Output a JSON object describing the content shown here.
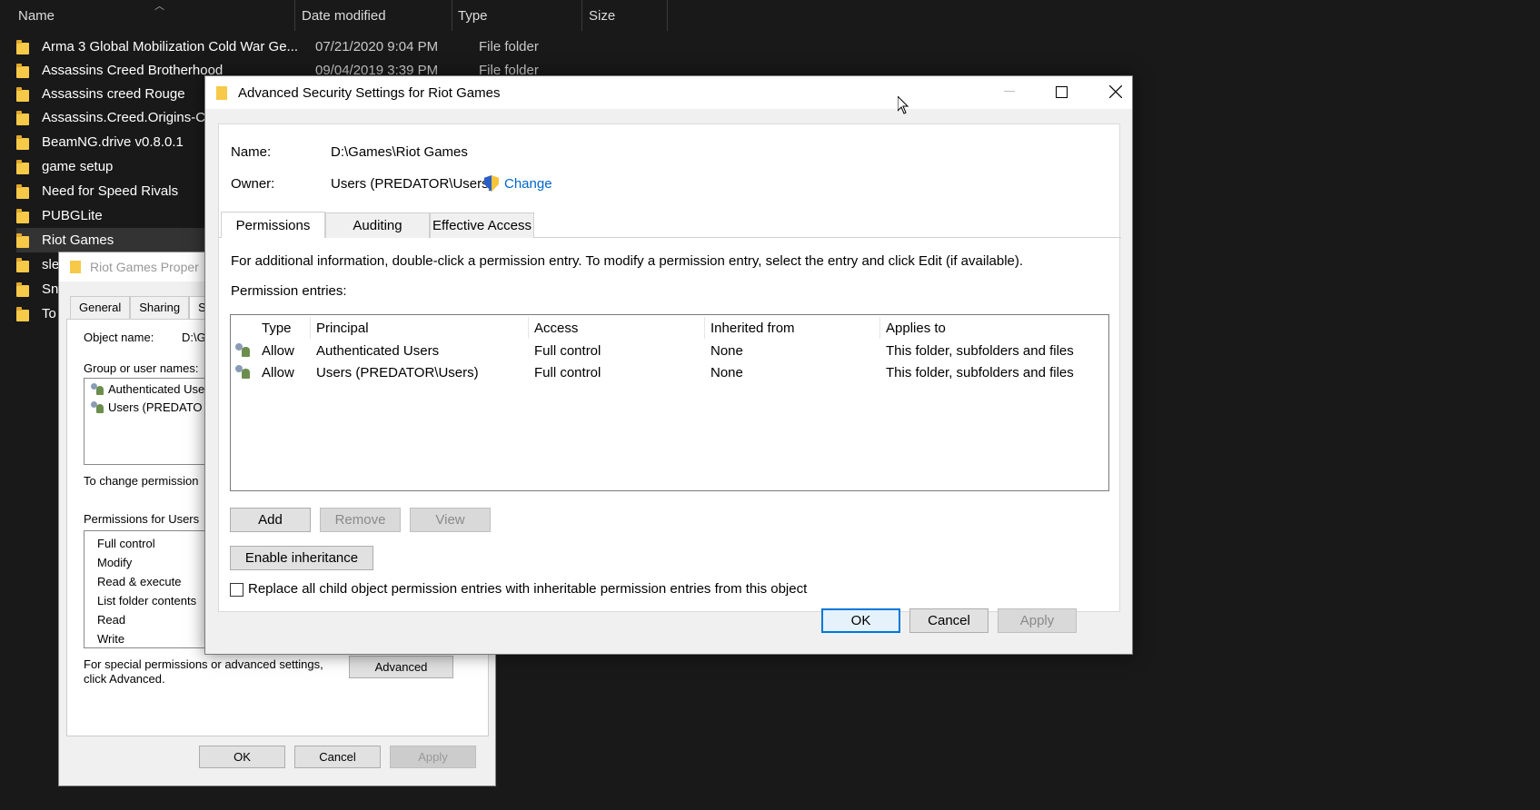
{
  "explorer": {
    "columns": {
      "name": "Name",
      "date": "Date modified",
      "type": "Type",
      "size": "Size"
    },
    "files": [
      {
        "name": "Arma 3 Global Mobilization Cold War Ge...",
        "date": "07/21/2020 9:04 PM",
        "type": "File folder"
      },
      {
        "name": "Assassins Creed Brotherhood",
        "date": "09/04/2019 3:39 PM",
        "type": "File folder"
      },
      {
        "name": "Assassins creed Rouge",
        "date": "",
        "type": ""
      },
      {
        "name": "Assassins.Creed.Origins-CPY",
        "date": "",
        "type": ""
      },
      {
        "name": "BeamNG.drive v0.8.0.1",
        "date": "",
        "type": ""
      },
      {
        "name": "game setup",
        "date": "",
        "type": ""
      },
      {
        "name": "Need for Speed Rivals",
        "date": "",
        "type": ""
      },
      {
        "name": "PUBGLite",
        "date": "",
        "type": ""
      },
      {
        "name": "Riot Games",
        "date": "",
        "type": ""
      },
      {
        "name": "sle",
        "date": "",
        "type": ""
      },
      {
        "name": "Sn",
        "date": "",
        "type": ""
      },
      {
        "name": "To",
        "date": "",
        "type": ""
      }
    ]
  },
  "properties": {
    "title": "Riot Games Proper",
    "tabs": [
      "General",
      "Sharing",
      "S"
    ],
    "object_name_label": "Object name:",
    "object_name_value": "D:\\G",
    "group_label": "Group or user names:",
    "users": [
      "Authenticated Use",
      "Users (PREDATO"
    ],
    "change_perm_text": "To change permission",
    "perm_for_label": "Permissions for Users",
    "permissions": [
      "Full control",
      "Modify",
      "Read & execute",
      "List folder contents",
      "Read",
      "Write"
    ],
    "special_text_1": "For special permissions or advanced settings,",
    "special_text_2": "click Advanced.",
    "advanced_btn": "Advanced",
    "ok": "OK",
    "cancel": "Cancel",
    "apply": "Apply"
  },
  "advanced": {
    "title": "Advanced Security Settings for Riot Games",
    "name_label": "Name:",
    "name_value": "D:\\Games\\Riot Games",
    "owner_label": "Owner:",
    "owner_value": "Users (PREDATOR\\Users)",
    "change_link": "Change",
    "tabs": [
      "Permissions",
      "Auditing",
      "Effective Access"
    ],
    "info_text": "For additional information, double-click a permission entry. To modify a permission entry, select the entry and click Edit (if available).",
    "entries_label": "Permission entries:",
    "table_headers": [
      "Type",
      "Principal",
      "Access",
      "Inherited from",
      "Applies to"
    ],
    "entries": [
      {
        "type": "Allow",
        "principal": "Authenticated Users",
        "access": "Full control",
        "inherited": "None",
        "applies": "This folder, subfolders and files"
      },
      {
        "type": "Allow",
        "principal": "Users (PREDATOR\\Users)",
        "access": "Full control",
        "inherited": "None",
        "applies": "This folder, subfolders and files"
      }
    ],
    "add_btn": "Add",
    "remove_btn": "Remove",
    "view_btn": "View",
    "enable_inheritance_btn": "Enable inheritance",
    "replace_checkbox_label": "Replace all child object permission entries with inheritable permission entries from this object",
    "ok": "OK",
    "cancel": "Cancel",
    "apply": "Apply"
  },
  "colors": {
    "explorer_bg": "#191919",
    "accent": "#0078d7",
    "link": "#0066cc",
    "folder": "#f7c948"
  }
}
